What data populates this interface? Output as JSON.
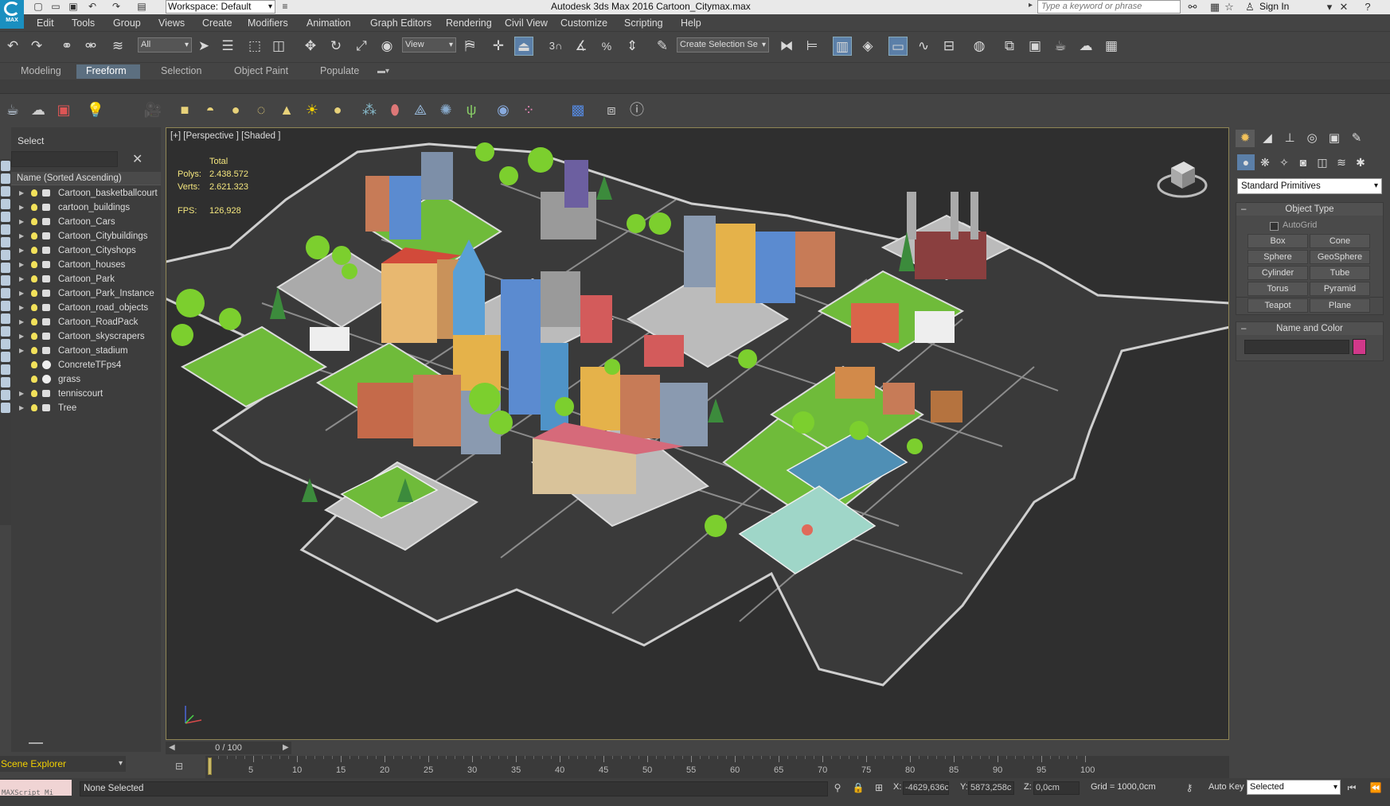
{
  "titlebar": {
    "logo_text": "MAX",
    "workspace": "Workspace: Default",
    "title": "Autodesk 3ds Max 2016     Cartoon_Citymax.max",
    "search_placeholder": "Type a keyword or phrase",
    "signin": "Sign In"
  },
  "menu": [
    "Edit",
    "Tools",
    "Group",
    "Views",
    "Create",
    "Modifiers",
    "Animation",
    "Graph Editors",
    "Rendering",
    "Civil View",
    "Customize",
    "Scripting",
    "Help"
  ],
  "toolbar": {
    "selection_filter": "All",
    "ref_coord": "View",
    "named_selection": "Create Selection Se",
    "snap_3": "3"
  },
  "ribbon": {
    "tabs": [
      "Modeling",
      "Freeform",
      "Selection",
      "Object Paint",
      "Populate"
    ],
    "active_tab": "Freeform"
  },
  "scene_explorer": {
    "title": "Select",
    "column_header": "Name (Sorted Ascending)",
    "items": [
      {
        "label": "Cartoon_basketballcourt",
        "type": "layer"
      },
      {
        "label": "cartoon_buildings",
        "type": "layer"
      },
      {
        "label": "Cartoon_Cars",
        "type": "layer"
      },
      {
        "label": "Cartoon_Citybuildings",
        "type": "layer"
      },
      {
        "label": "Cartoon_Cityshops",
        "type": "layer"
      },
      {
        "label": "Cartoon_houses",
        "type": "layer"
      },
      {
        "label": "Cartoon_Park",
        "type": "layer"
      },
      {
        "label": "Cartoon_Park_Instance",
        "type": "layer"
      },
      {
        "label": "Cartoon_road_objects",
        "type": "layer"
      },
      {
        "label": "Cartoon_RoadPack",
        "type": "layer"
      },
      {
        "label": "Cartoon_skyscrapers",
        "type": "layer"
      },
      {
        "label": "Cartoon_stadium",
        "type": "layer"
      },
      {
        "label": "ConcreteTFps4",
        "type": "material"
      },
      {
        "label": "grass",
        "type": "material"
      },
      {
        "label": "tenniscourt",
        "type": "layer"
      },
      {
        "label": "Tree",
        "type": "layer"
      }
    ],
    "footer": "Scene Explorer"
  },
  "viewport": {
    "label": "[+] [Perspective ] [Shaded ]",
    "stats_header": "Total",
    "polys_label": "Polys:",
    "polys": "2.438.572",
    "verts_label": "Verts:",
    "verts": "2.621.323",
    "fps_label": "FPS:",
    "fps": "126,928"
  },
  "timeline": {
    "slider": "0 / 100",
    "ticks": [
      "5",
      "10",
      "15",
      "20",
      "25",
      "30",
      "35",
      "40",
      "45",
      "50",
      "55",
      "60",
      "65",
      "70",
      "75",
      "80",
      "85",
      "90",
      "95",
      "100"
    ]
  },
  "status": {
    "maxscript": "MAXScript Mi",
    "message": "None Selected",
    "x_label": "X:",
    "x_value": "-4629,636c",
    "y_label": "Y:",
    "y_value": "5873,258c",
    "z_label": "Z:",
    "z_value": "0,0cm",
    "grid": "Grid = 1000,0cm",
    "autokey": "Auto Key",
    "selected": "Selected"
  },
  "command_panel": {
    "category": "Standard Primitives",
    "object_type_title": "Object Type",
    "autogrid": "AutoGrid",
    "primitives": [
      "Box",
      "Cone",
      "Sphere",
      "GeoSphere",
      "Cylinder",
      "Tube",
      "Torus",
      "Pyramid",
      "Teapot",
      "Plane"
    ],
    "name_color_title": "Name and Color",
    "object_color": "#d1388a"
  },
  "colors": {
    "viewport_bg": "#2f2f2f",
    "grass": "#6fbb3a",
    "road": "#3a3a3a",
    "curb": "#cfcfcf",
    "stats": "#f4e67e",
    "active_blue": "#5b7fa8"
  }
}
